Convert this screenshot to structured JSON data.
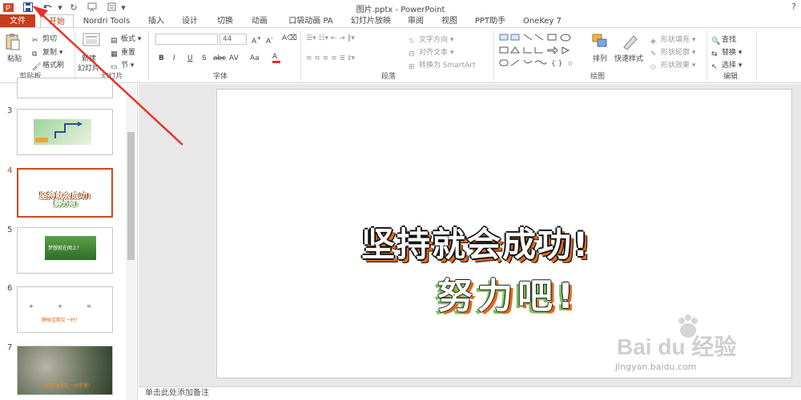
{
  "window": {
    "title": "图片.pptx - PowerPoint",
    "help": "?"
  },
  "tabs": [
    "文件",
    "开始",
    "Nordri Tools",
    "插入",
    "设计",
    "切换",
    "动画",
    "口袋动画 PA",
    "幻灯片放映",
    "审阅",
    "视图",
    "PPT助手",
    "OneKey 7"
  ],
  "ribbon": {
    "clipboard": {
      "paste": "粘贴",
      "cut": "剪切",
      "copy": "复制",
      "format_painter": "格式刷",
      "label": "剪贴板"
    },
    "slides": {
      "new": "新建",
      "new2": "幻灯片",
      "layout": "板式",
      "reset": "重置",
      "section": "节",
      "label": "幻灯片"
    },
    "font": {
      "size": "44",
      "label": "字体",
      "buttons": [
        "B",
        "I",
        "U",
        "S",
        "abc",
        "AV",
        "Aa",
        "A"
      ]
    },
    "paragraph": {
      "text_direction": "文字方向",
      "align_text": "对齐文本",
      "smartart": "转换为 SmartArt",
      "label": "段落"
    },
    "drawing": {
      "arrange": "排列",
      "quick_styles": "快速样式",
      "fill": "形状填充",
      "outline": "形状轮廓",
      "effects": "形状效果",
      "label": "绘图"
    },
    "editing": {
      "find": "查找",
      "replace": "替换",
      "select": "选择",
      "label": "编辑"
    }
  },
  "slides_panel": {
    "numbers": [
      "3",
      "4",
      "5",
      "6",
      "7"
    ],
    "thumb5_text": "梦想就在网上！",
    "thumb6_text": "静候佳期又一村！",
    "thumb7_text": "把梦想放在一分手里！"
  },
  "slide": {
    "line1": "坚持就会成功!",
    "line2": "努力吧!"
  },
  "notes_placeholder": "单击此处添加备注",
  "watermark": {
    "logo": "Bai du 经验",
    "url": "jingyan.baidu.com"
  },
  "colors": {
    "accent": "#c43e1c",
    "arrow": "#e8322a",
    "orange": "#e06a1a",
    "green": "#7cc05c"
  }
}
